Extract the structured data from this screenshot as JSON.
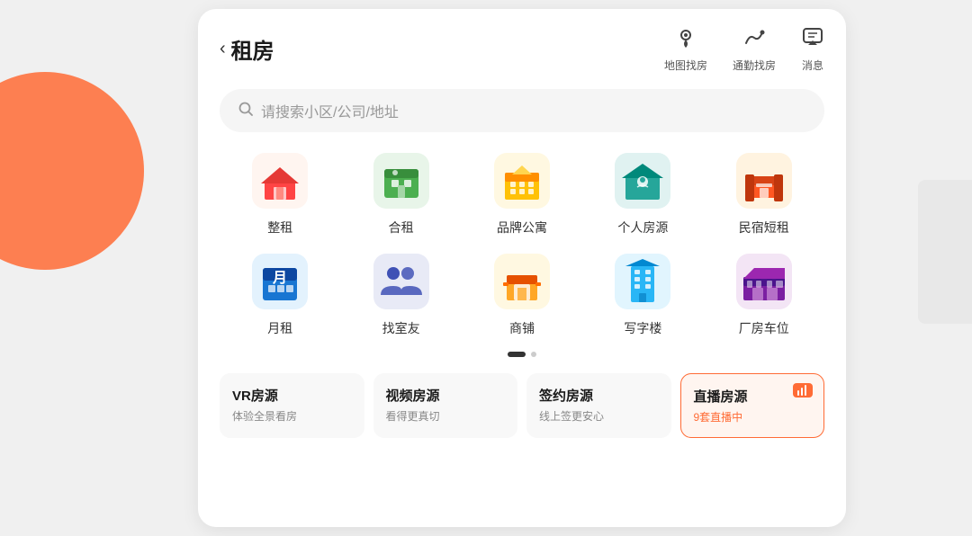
{
  "page": {
    "title": "租房",
    "back_label": "‹"
  },
  "header": {
    "actions": [
      {
        "id": "map",
        "icon": "📍",
        "label": "地图找房"
      },
      {
        "id": "commute",
        "icon": "🚇",
        "label": "通勤找房"
      },
      {
        "id": "message",
        "icon": "💬",
        "label": "消息"
      }
    ]
  },
  "search": {
    "placeholder": "请搜索小区/公司/地址"
  },
  "grid_row1": [
    {
      "id": "whole-rent",
      "label": "整租",
      "bg": "#F5F5F5"
    },
    {
      "id": "shared-rent",
      "label": "合租",
      "bg": "#F5F5F5"
    },
    {
      "id": "brand-apt",
      "label": "品牌公寓",
      "bg": "#F5F5F5"
    },
    {
      "id": "personal",
      "label": "个人房源",
      "bg": "#F5F5F5"
    },
    {
      "id": "minsu",
      "label": "民宿短租",
      "bg": "#F5F5F5"
    }
  ],
  "grid_row2": [
    {
      "id": "monthly",
      "label": "月租",
      "bg": "#F5F5F5"
    },
    {
      "id": "roommate",
      "label": "找室友",
      "bg": "#F5F5F5"
    },
    {
      "id": "shop",
      "label": "商铺",
      "bg": "#F5F5F5"
    },
    {
      "id": "office",
      "label": "写字楼",
      "bg": "#F5F5F5"
    },
    {
      "id": "factory",
      "label": "厂房车位",
      "bg": "#F5F5F5"
    }
  ],
  "bottom_cards": [
    {
      "id": "vr",
      "title": "VR房源",
      "sub": "体验全景看房",
      "highlight": false
    },
    {
      "id": "video",
      "title": "视频房源",
      "sub": "看得更真切",
      "highlight": false
    },
    {
      "id": "signed",
      "title": "签约房源",
      "sub": "线上签更安心",
      "highlight": false
    },
    {
      "id": "live",
      "title": "直播房源",
      "sub": "9套直播中",
      "highlight": true,
      "badge": "📊"
    }
  ],
  "dots": {
    "active": 0,
    "total": 2
  }
}
